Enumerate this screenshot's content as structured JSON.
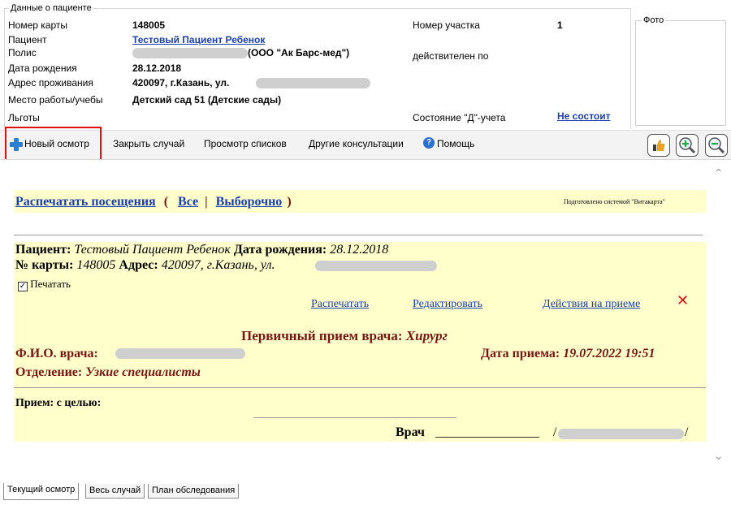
{
  "patient": {
    "legend": "Данные о пациенте",
    "card_label": "Номер карты",
    "card_value": "148005",
    "patient_label": "Пациент",
    "patient_value": "Тестовый Пациент Ребенок",
    "policy_label": "Полис",
    "policy_value": "(ООО \"Ак Барс-мед\")",
    "dob_label": "Дата рождения",
    "dob_value": "28.12.2018",
    "address_label": "Адрес проживания",
    "address_value": "420097, г.Казань, ул.",
    "work_label": "Место работы/учебы",
    "work_value": "Детский сад 51 (Детские сады)",
    "benefits_label": "Льготы",
    "district_label": "Номер участка",
    "district_value": "1",
    "valid_label": "действителен по",
    "d_status_label": "Состояние \"Д\"-учета",
    "d_status_value": "Не состоит",
    "photo_label": "Фото"
  },
  "toolbar": {
    "new_exam": "Новый осмотр",
    "close_case": "Закрыть случай",
    "view_lists": "Просмотр списков",
    "other_consult": "Другие консультации",
    "help": "Помощь"
  },
  "content": {
    "print_visits": "Распечатать посещения",
    "paren_open": "(",
    "all": "Все",
    "sep": "|",
    "selective": "Выборочно",
    "paren_close": ")",
    "prepared_by": "Подготовлено системой \"Витакарта\"",
    "patient_label": "Пациент:",
    "patient_name": "Тестовый Пациент Ребенок",
    "dob_label": "Дата рождения:",
    "dob": "28.12.2018",
    "card_label": "№ карты:",
    "card": "148005",
    "address_label": "Адрес:",
    "address": "420097, г.Казань, ул.",
    "print_checkbox": "Печатать",
    "action_print": "Распечатать",
    "action_edit": "Редактировать",
    "action_actions": "Действия на приеме",
    "visit_title": "Первичный прием врача:",
    "visit_specialty": "Хирург",
    "doctor_label": "Ф.И.О. врача:",
    "visit_date_label": "Дата приема:",
    "visit_date": "19.07.2022 19:51",
    "dept_label": "Отделение:",
    "dept": "Узкие специалисты",
    "purpose_label": "Прием: с целью:",
    "doctor_sign_label": "Врач",
    "sign_line": "________________",
    "slash1": "/",
    "slash2": "/"
  },
  "tabs": [
    "Текущий осмотр",
    "Весь случай",
    "План обследования"
  ],
  "colors": {
    "accent_red": "#e01010",
    "link": "#1a3fb0",
    "maroon": "#7a1515",
    "highlight_bg": "#ffffcc"
  }
}
